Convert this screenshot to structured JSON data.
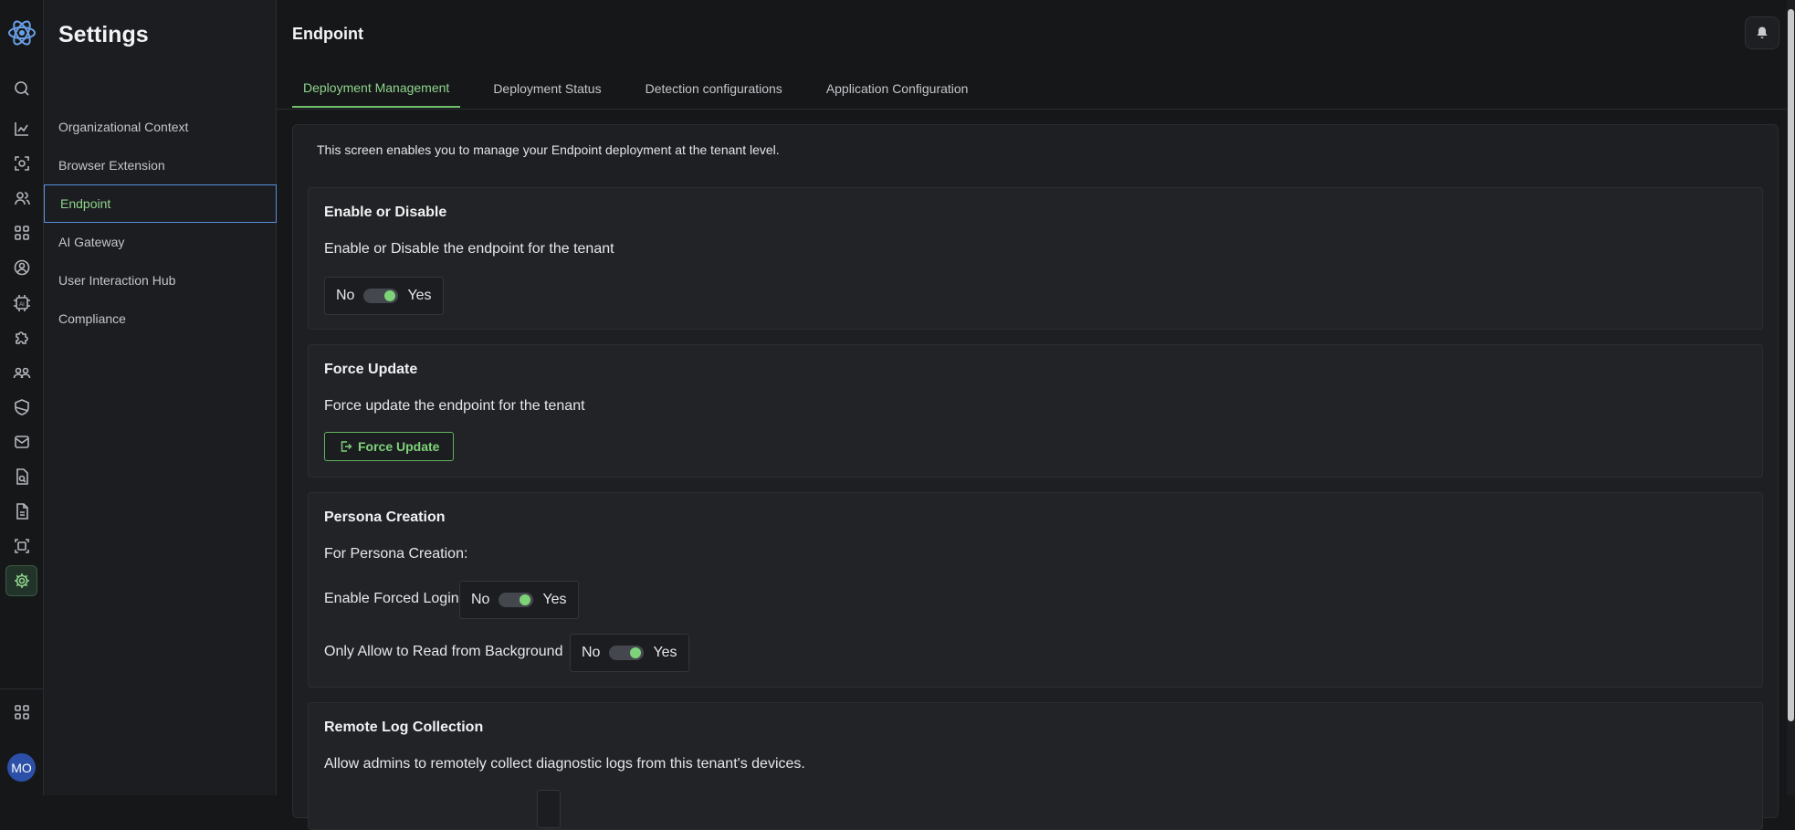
{
  "colors": {
    "accent_green": "#7ed37a",
    "active_nav_border": "#5b8fe0",
    "avatar_bg": "#2c4fa8"
  },
  "rail": {
    "icons": [
      "search-icon",
      "chart-icon",
      "scan-icon",
      "users-icon",
      "apps-icon",
      "profile-icon",
      "ai-chip-icon",
      "puzzle-icon",
      "team-icon",
      "shield-icon",
      "mail-icon",
      "doc-search-icon",
      "file-icon",
      "scan-frame-icon",
      "gear-icon"
    ],
    "active_icon": "gear-icon",
    "bottom_icon": "apps-grid-icon",
    "avatar": "MO"
  },
  "settings": {
    "title": "Settings",
    "items": [
      {
        "label": "Organizational Context"
      },
      {
        "label": "Browser Extension"
      },
      {
        "label": "Endpoint"
      },
      {
        "label": "AI Gateway"
      },
      {
        "label": "User Interaction Hub"
      },
      {
        "label": "Compliance"
      }
    ],
    "active_item": "Endpoint"
  },
  "header": {
    "title": "Endpoint"
  },
  "tabs": [
    {
      "label": "Deployment Management"
    },
    {
      "label": "Deployment Status"
    },
    {
      "label": "Detection configurations"
    },
    {
      "label": "Application Configuration"
    }
  ],
  "active_tab": "Deployment Management",
  "content": {
    "intro": "This screen enables you to manage your Endpoint deployment at the tenant level.",
    "enable": {
      "title": "Enable or Disable",
      "desc": "Enable or Disable the endpoint for the tenant",
      "no": "No",
      "yes": "Yes",
      "value": "Yes"
    },
    "force_update": {
      "title": "Force Update",
      "desc": "Force update the endpoint for the tenant",
      "button": "Force Update"
    },
    "persona": {
      "title": "Persona Creation",
      "desc": "For Persona Creation:",
      "forced_login_label": "Enable Forced Login",
      "forced_login_value": "Yes",
      "read_bg_label": "Only Allow to Read from Background",
      "read_bg_value": "Yes",
      "no": "No",
      "yes": "Yes"
    },
    "remote_log": {
      "title": "Remote Log Collection",
      "desc": "Allow admins to remotely collect diagnostic logs from this tenant's devices."
    }
  }
}
